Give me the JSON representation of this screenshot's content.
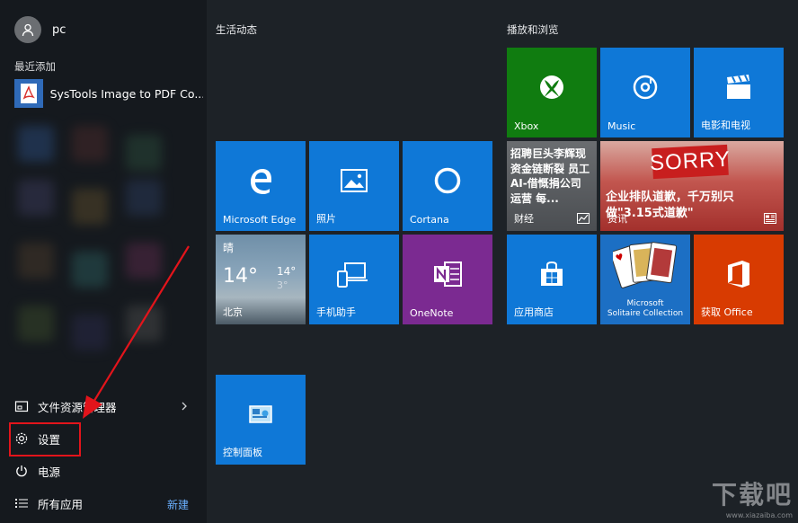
{
  "user": {
    "name": "pc"
  },
  "recent": {
    "title": "最近添加",
    "items": [
      {
        "label": "SysTools Image to PDF Co..."
      }
    ]
  },
  "bottom_menu": {
    "file_explorer": "文件资源管理器",
    "settings": "设置",
    "power": "电源",
    "all_apps": "所有应用",
    "new": "新建"
  },
  "groups": {
    "life": "生活动态",
    "play": "播放和浏览"
  },
  "tiles": {
    "edge": "Microsoft Edge",
    "photos": "照片",
    "cortana": "Cortana",
    "weather": {
      "condition": "晴",
      "temp": "14°",
      "high": "14°",
      "low": "3°",
      "city": "北京"
    },
    "phone": "手机助手",
    "onenote": "OneNote",
    "control_panel": "控制面板",
    "xbox": "Xbox",
    "music": "Music",
    "movies": "电影和电视",
    "finance": {
      "headline": "招聘巨头李辉现资金链断裂 员工AI-借慨捐公司运营 每...",
      "label": "财经"
    },
    "news": {
      "sign": "SORRY",
      "headline": "企业排队道歉，千万别只做\"3.15式道歉\"",
      "label": "资讯"
    },
    "store": "应用商店",
    "solitaire": {
      "line1": "Microsoft",
      "line2": "Solitaire Collection"
    },
    "office": "获取 Office"
  },
  "watermark": {
    "big": "下载吧",
    "small": "www.xiazaiba.com"
  },
  "colors": {
    "tile_blue": "#0f78d7",
    "onenote": "#7b2a91",
    "xbox": "#107c10",
    "office": "#d83b01",
    "highlight": "#e3141b"
  }
}
